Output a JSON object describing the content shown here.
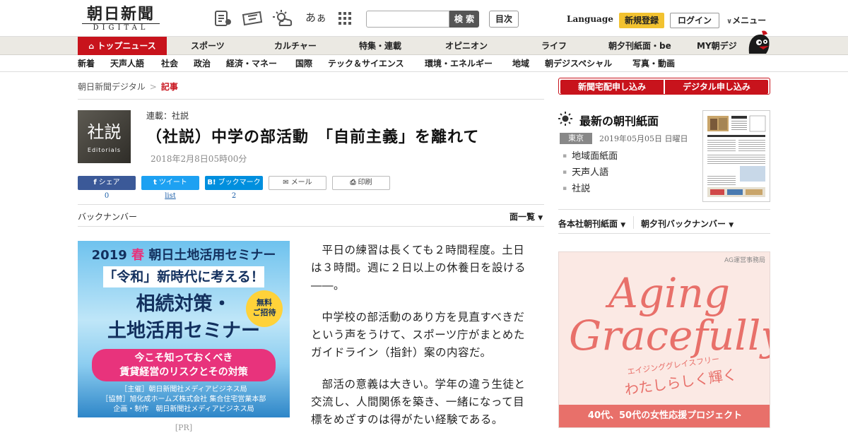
{
  "header": {
    "logo_main": "朝日新聞",
    "logo_sub": "DIGITAL",
    "icons": [
      "news-feed-icon",
      "ticket-icon",
      "weather-icon",
      "font-size-icon",
      "grid-menu-icon"
    ],
    "font_size_icon_text": "あぁ",
    "search_placeholder": "",
    "search_button": "検 索",
    "toc_button": "目次",
    "language": "Language",
    "register": "新規登録",
    "login": "ログイン",
    "menu": "メニュー"
  },
  "nav_primary": [
    {
      "label": "トップニュース"
    },
    {
      "label": "スポーツ"
    },
    {
      "label": "カルチャー"
    },
    {
      "label": "特集・連載"
    },
    {
      "label": "オピニオン"
    },
    {
      "label": "ライフ"
    },
    {
      "label": "朝夕刊紙面・be"
    },
    {
      "label": "MY朝デジ"
    }
  ],
  "nav_secondary": [
    {
      "label": "新着"
    },
    {
      "label": "天声人語"
    },
    {
      "label": "社会"
    },
    {
      "label": "政治"
    },
    {
      "label": "経済・マネー"
    },
    {
      "label": "国際"
    },
    {
      "label": "テック＆サイエンス"
    },
    {
      "label": "環境・エネルギー"
    },
    {
      "label": "地域"
    },
    {
      "label": "朝デジスペシャル"
    },
    {
      "label": "写真・動画"
    }
  ],
  "breadcrumb": {
    "home": "朝日新聞デジタル",
    "sep": ">",
    "current": "記事"
  },
  "article": {
    "logo_kanji": "社説",
    "logo_en": "Editorials",
    "series": "連載：社説",
    "title": "（社説）中学の部活動　「自前主義」を離れて",
    "date": "2018年2月8日05時00分",
    "share": {
      "facebook": {
        "icon": "f",
        "label": "シェア",
        "count": "0"
      },
      "twitter": {
        "icon": "t",
        "label": "ツイート",
        "count": "list"
      },
      "hatena": {
        "icon": "B!",
        "label": "ブックマーク",
        "count": "2"
      },
      "mail": {
        "icon": "✉",
        "label": "メール"
      },
      "print": {
        "icon": "⎙",
        "label": "印刷"
      }
    },
    "back_number": "バックナンバー",
    "list_menu": "面一覧",
    "paragraphs": [
      "平日の練習は長くても２時間程度。土日は３時間。週に２日以上の休養日を設ける――。",
      "中学校の部活動のあり方を見直すべきだという声をうけて、スポーツ庁がまとめたガイドライン（指針）案の内容だ。",
      "部活の意義は大きい。学年の違う生徒と交流し、人間関係を築き、一緒になって目標をめざすのは得がたい経験である。"
    ]
  },
  "ad_left": {
    "year": "2019",
    "spring": "春",
    "line1": "朝日土地活用セミナー",
    "line2": "「令和」新時代に考える！",
    "line3": "相続対策・",
    "line4": "土地活用セミナー",
    "badge": [
      "無料",
      "ご招待"
    ],
    "pink1": "今こそ知っておくべき",
    "pink2": "賃貸経営のリスクとその対策",
    "foot1": "［主催］朝日新聞社メディアビジネス局",
    "foot2": "［協賛］旭化成ホームズ株式会社 集合住宅営業本部",
    "foot3": "企画・制作　朝日新聞社メディアビジネス局",
    "pr": "[PR]"
  },
  "sidebar": {
    "btn_home_delivery": "新聞宅配申し込み",
    "btn_digital": "デジタル申し込み",
    "chokan_title": "最新の朝刊紙面",
    "region": "東京",
    "date": "2019年05月05日 日曜日",
    "links": [
      "地域面紙面",
      "天声人語",
      "社説"
    ],
    "link_honsha": "各本社朝刊紙面",
    "link_yukan": "朝夕刊バックナンバー"
  },
  "ad_right": {
    "office": "AG運営事務局",
    "word1": "Aging",
    "word2": "Gracefully",
    "kana": "エイジンググレイスフリー",
    "tagline": "わたしらしく輝く",
    "band": "40代、50代の女性応援プロジェクト"
  },
  "colors": {
    "accent_red": "#c8131c",
    "register_yellow": "#f2c230",
    "nav_bg": "#ebe9e3",
    "ad_pink": "#e8706a"
  }
}
